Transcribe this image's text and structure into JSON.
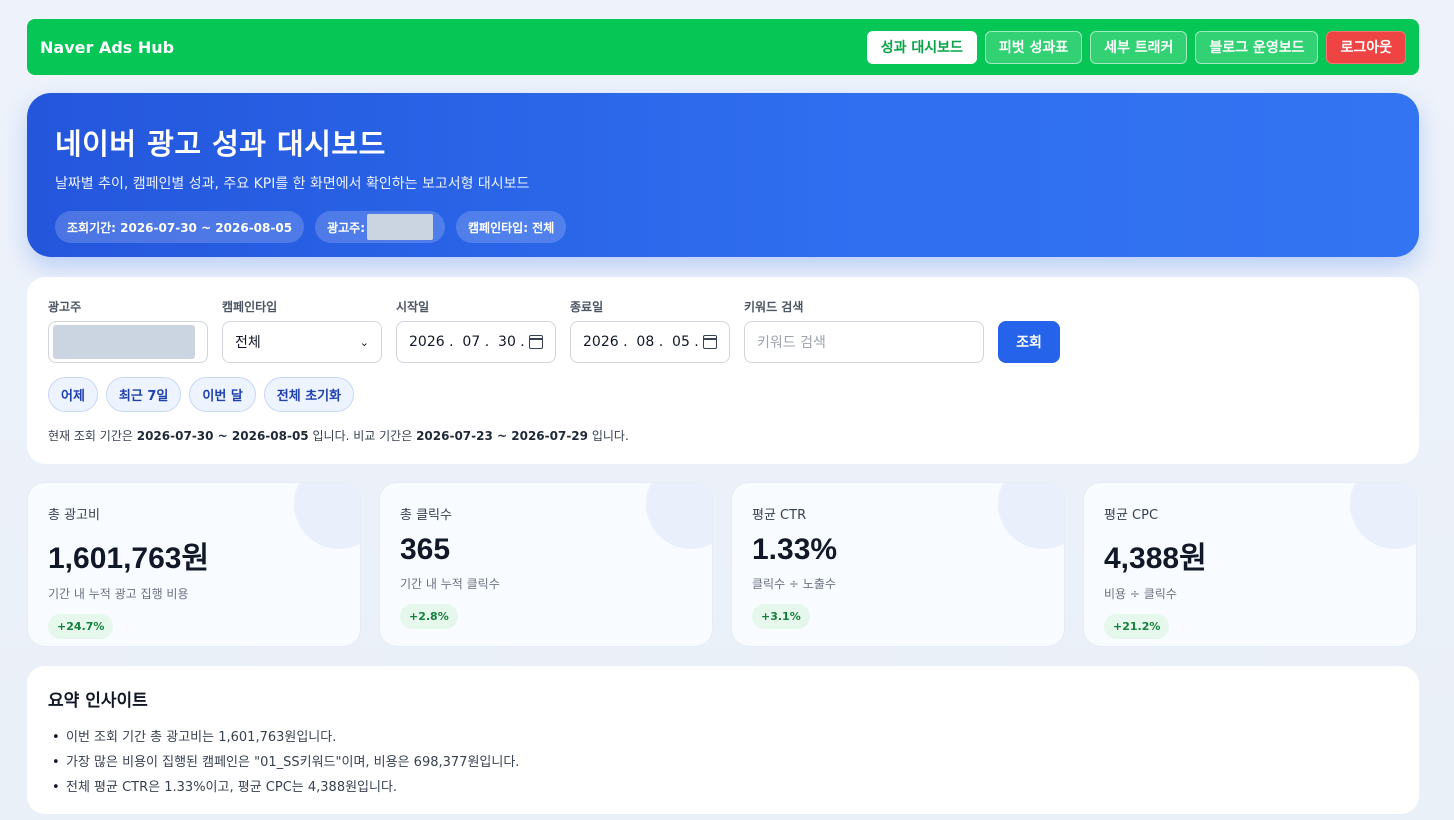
{
  "nav": {
    "brand": "Naver Ads Hub",
    "buttons": [
      "성과 대시보드",
      "피벗 성과표",
      "세부 트래커",
      "블로그 운영보드"
    ],
    "logout": "로그아웃"
  },
  "hero": {
    "title": "네이버 광고 성과 대시보드",
    "subtitle": "날짜별 추이, 캠페인별 성과, 주요 KPI를 한 화면에서 확인하는 보고서형 대시보드",
    "chip_period": "조회기간: 2026-07-30 ~ 2026-08-05",
    "chip_advertiser": "광고주:",
    "chip_campaign": "캠페인타입: 전체"
  },
  "filters": {
    "advertiser_label": "광고주",
    "campaign_label": "캠페인타입",
    "campaign_value": "전체",
    "start_label": "시작일",
    "start_value": "2026 .  07 .  30 .",
    "end_label": "종료일",
    "end_value": "2026 .  08 .  05 .",
    "keyword_label": "키워드 검색",
    "keyword_placeholder": "키워드 검색",
    "search_button": "조회",
    "quick": [
      "어제",
      "최근 7일",
      "이번 달",
      "전체 초기화"
    ],
    "note_prefix": "현재 조회 기간은 ",
    "note_current": "2026-07-30 ~ 2026-08-05",
    "note_mid": " 입니다. 비교 기간은 ",
    "note_compare": "2026-07-23 ~ 2026-07-29",
    "note_suffix": " 입니다."
  },
  "kpis": [
    {
      "label": "총 광고비",
      "value": "1,601,763원",
      "desc": "기간 내 누적 광고 집행 비용",
      "badge": "+24.7%"
    },
    {
      "label": "총 클릭수",
      "value": "365",
      "desc": "기간 내 누적 클릭수",
      "badge": "+2.8%"
    },
    {
      "label": "평균 CTR",
      "value": "1.33%",
      "desc": "클릭수 ÷ 노출수",
      "badge": "+3.1%"
    },
    {
      "label": "평균 CPC",
      "value": "4,388원",
      "desc": "비용 ÷ 클릭수",
      "badge": "+21.2%"
    }
  ],
  "insights": {
    "title": "요약 인사이트",
    "items": [
      "이번 조회 기간 총 광고비는 1,601,763원입니다.",
      "가장 많은 비용이 집행된 캠페인은 \"01_SS키워드\"이며, 비용은 698,377원입니다.",
      "전체 평균 CTR은 1.33%이고, 평균 CPC는 4,388원입니다."
    ]
  },
  "colors": {
    "nav_green": "#06c755",
    "hero_blue": "#2f6ff0",
    "primary": "#2563eb",
    "logout": "#ef4444",
    "badge_green": "#15803d"
  }
}
